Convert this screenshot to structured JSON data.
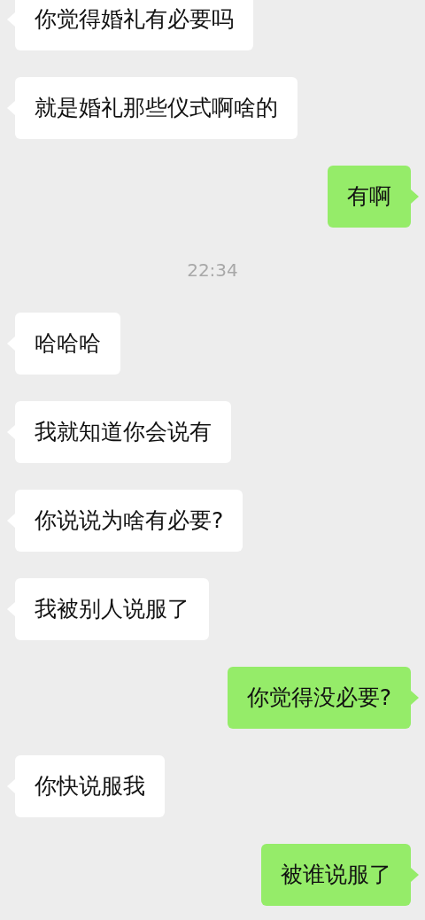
{
  "messages": [
    {
      "kind": "incoming",
      "text": "你觉得婚礼有必要吗"
    },
    {
      "kind": "incoming",
      "text": "就是婚礼那些仪式啊啥的"
    },
    {
      "kind": "outgoing",
      "text": "有啊"
    },
    {
      "kind": "timestamp",
      "text": "22:34"
    },
    {
      "kind": "incoming",
      "text": "哈哈哈"
    },
    {
      "kind": "incoming",
      "text": "我就知道你会说有"
    },
    {
      "kind": "incoming",
      "text": "你说说为啥有必要?"
    },
    {
      "kind": "incoming",
      "text": "我被别人说服了"
    },
    {
      "kind": "outgoing",
      "text": "你觉得没必要?"
    },
    {
      "kind": "incoming",
      "text": "你快说服我"
    },
    {
      "kind": "outgoing",
      "text": "被谁说服了"
    }
  ]
}
